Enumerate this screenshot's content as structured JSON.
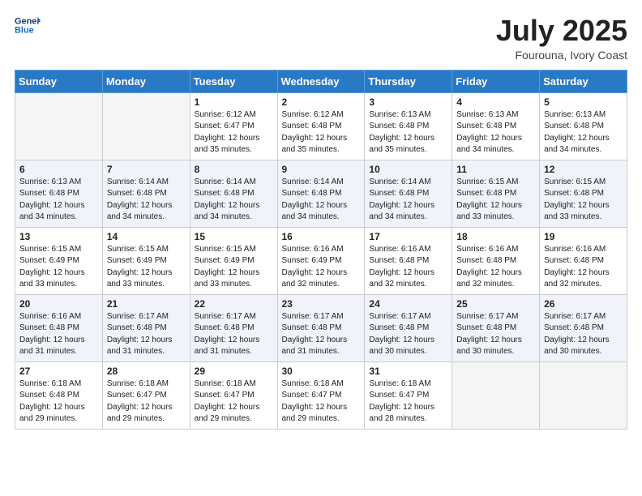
{
  "logo": {
    "line1": "General",
    "line2": "Blue"
  },
  "title": "July 2025",
  "location": "Fourouna, Ivory Coast",
  "weekdays": [
    "Sunday",
    "Monday",
    "Tuesday",
    "Wednesday",
    "Thursday",
    "Friday",
    "Saturday"
  ],
  "weeks": [
    [
      {
        "day": "",
        "info": ""
      },
      {
        "day": "",
        "info": ""
      },
      {
        "day": "1",
        "info": "Sunrise: 6:12 AM\nSunset: 6:47 PM\nDaylight: 12 hours and 35 minutes."
      },
      {
        "day": "2",
        "info": "Sunrise: 6:12 AM\nSunset: 6:48 PM\nDaylight: 12 hours and 35 minutes."
      },
      {
        "day": "3",
        "info": "Sunrise: 6:13 AM\nSunset: 6:48 PM\nDaylight: 12 hours and 35 minutes."
      },
      {
        "day": "4",
        "info": "Sunrise: 6:13 AM\nSunset: 6:48 PM\nDaylight: 12 hours and 34 minutes."
      },
      {
        "day": "5",
        "info": "Sunrise: 6:13 AM\nSunset: 6:48 PM\nDaylight: 12 hours and 34 minutes."
      }
    ],
    [
      {
        "day": "6",
        "info": "Sunrise: 6:13 AM\nSunset: 6:48 PM\nDaylight: 12 hours and 34 minutes."
      },
      {
        "day": "7",
        "info": "Sunrise: 6:14 AM\nSunset: 6:48 PM\nDaylight: 12 hours and 34 minutes."
      },
      {
        "day": "8",
        "info": "Sunrise: 6:14 AM\nSunset: 6:48 PM\nDaylight: 12 hours and 34 minutes."
      },
      {
        "day": "9",
        "info": "Sunrise: 6:14 AM\nSunset: 6:48 PM\nDaylight: 12 hours and 34 minutes."
      },
      {
        "day": "10",
        "info": "Sunrise: 6:14 AM\nSunset: 6:48 PM\nDaylight: 12 hours and 34 minutes."
      },
      {
        "day": "11",
        "info": "Sunrise: 6:15 AM\nSunset: 6:48 PM\nDaylight: 12 hours and 33 minutes."
      },
      {
        "day": "12",
        "info": "Sunrise: 6:15 AM\nSunset: 6:48 PM\nDaylight: 12 hours and 33 minutes."
      }
    ],
    [
      {
        "day": "13",
        "info": "Sunrise: 6:15 AM\nSunset: 6:49 PM\nDaylight: 12 hours and 33 minutes."
      },
      {
        "day": "14",
        "info": "Sunrise: 6:15 AM\nSunset: 6:49 PM\nDaylight: 12 hours and 33 minutes."
      },
      {
        "day": "15",
        "info": "Sunrise: 6:15 AM\nSunset: 6:49 PM\nDaylight: 12 hours and 33 minutes."
      },
      {
        "day": "16",
        "info": "Sunrise: 6:16 AM\nSunset: 6:49 PM\nDaylight: 12 hours and 32 minutes."
      },
      {
        "day": "17",
        "info": "Sunrise: 6:16 AM\nSunset: 6:48 PM\nDaylight: 12 hours and 32 minutes."
      },
      {
        "day": "18",
        "info": "Sunrise: 6:16 AM\nSunset: 6:48 PM\nDaylight: 12 hours and 32 minutes."
      },
      {
        "day": "19",
        "info": "Sunrise: 6:16 AM\nSunset: 6:48 PM\nDaylight: 12 hours and 32 minutes."
      }
    ],
    [
      {
        "day": "20",
        "info": "Sunrise: 6:16 AM\nSunset: 6:48 PM\nDaylight: 12 hours and 31 minutes."
      },
      {
        "day": "21",
        "info": "Sunrise: 6:17 AM\nSunset: 6:48 PM\nDaylight: 12 hours and 31 minutes."
      },
      {
        "day": "22",
        "info": "Sunrise: 6:17 AM\nSunset: 6:48 PM\nDaylight: 12 hours and 31 minutes."
      },
      {
        "day": "23",
        "info": "Sunrise: 6:17 AM\nSunset: 6:48 PM\nDaylight: 12 hours and 31 minutes."
      },
      {
        "day": "24",
        "info": "Sunrise: 6:17 AM\nSunset: 6:48 PM\nDaylight: 12 hours and 30 minutes."
      },
      {
        "day": "25",
        "info": "Sunrise: 6:17 AM\nSunset: 6:48 PM\nDaylight: 12 hours and 30 minutes."
      },
      {
        "day": "26",
        "info": "Sunrise: 6:17 AM\nSunset: 6:48 PM\nDaylight: 12 hours and 30 minutes."
      }
    ],
    [
      {
        "day": "27",
        "info": "Sunrise: 6:18 AM\nSunset: 6:48 PM\nDaylight: 12 hours and 29 minutes."
      },
      {
        "day": "28",
        "info": "Sunrise: 6:18 AM\nSunset: 6:47 PM\nDaylight: 12 hours and 29 minutes."
      },
      {
        "day": "29",
        "info": "Sunrise: 6:18 AM\nSunset: 6:47 PM\nDaylight: 12 hours and 29 minutes."
      },
      {
        "day": "30",
        "info": "Sunrise: 6:18 AM\nSunset: 6:47 PM\nDaylight: 12 hours and 29 minutes."
      },
      {
        "day": "31",
        "info": "Sunrise: 6:18 AM\nSunset: 6:47 PM\nDaylight: 12 hours and 28 minutes."
      },
      {
        "day": "",
        "info": ""
      },
      {
        "day": "",
        "info": ""
      }
    ]
  ]
}
